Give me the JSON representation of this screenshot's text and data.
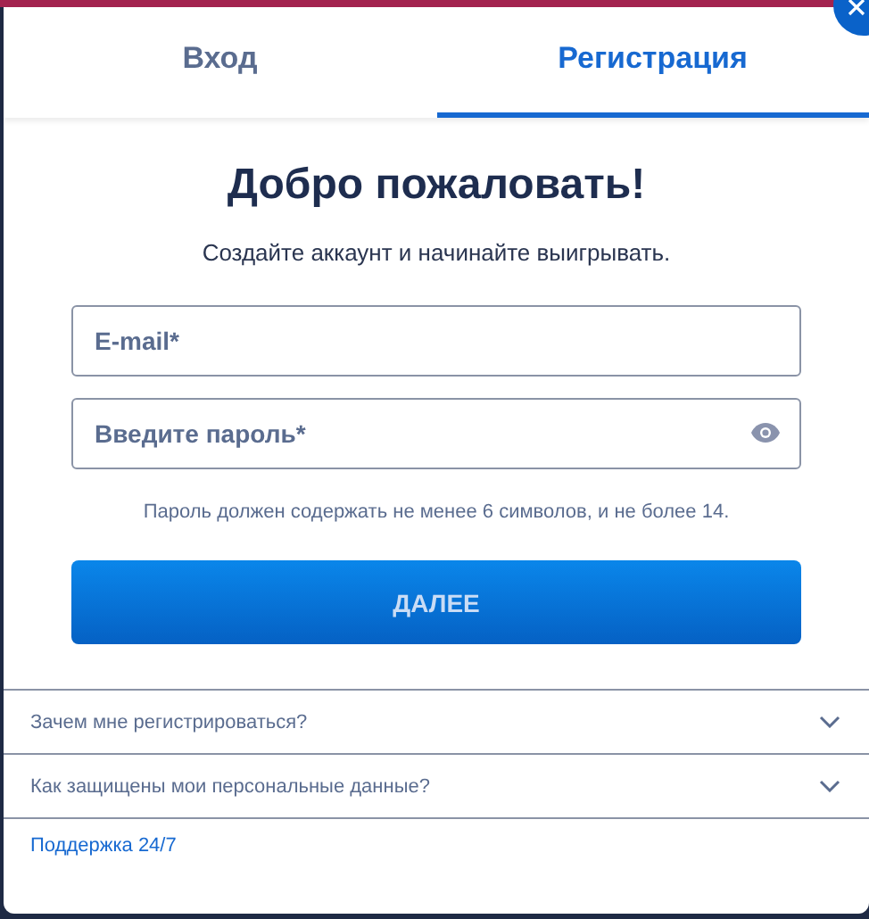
{
  "tabs": [
    {
      "label": "Вход",
      "selected": false
    },
    {
      "label": "Регистрация",
      "selected": true
    }
  ],
  "heading": "Добро пожаловать!",
  "subtitle": "Создайте аккаунт и начинайте выигрывать.",
  "fields": [
    {
      "kind": "text",
      "placeholder": "E-mail*"
    },
    {
      "kind": "password",
      "placeholder": "Введите пароль*"
    }
  ],
  "hint": "Пароль должен содержать не менее 6 символов, и не более 14.",
  "submit": "ДАЛЕЕ",
  "faq": [
    {
      "question": "Зачем мне регистрироваться?",
      "expanded": false
    },
    {
      "question": "Как защищены мои персональные данные?",
      "expanded": false
    }
  ],
  "support_link": "Поддержка 24/7"
}
